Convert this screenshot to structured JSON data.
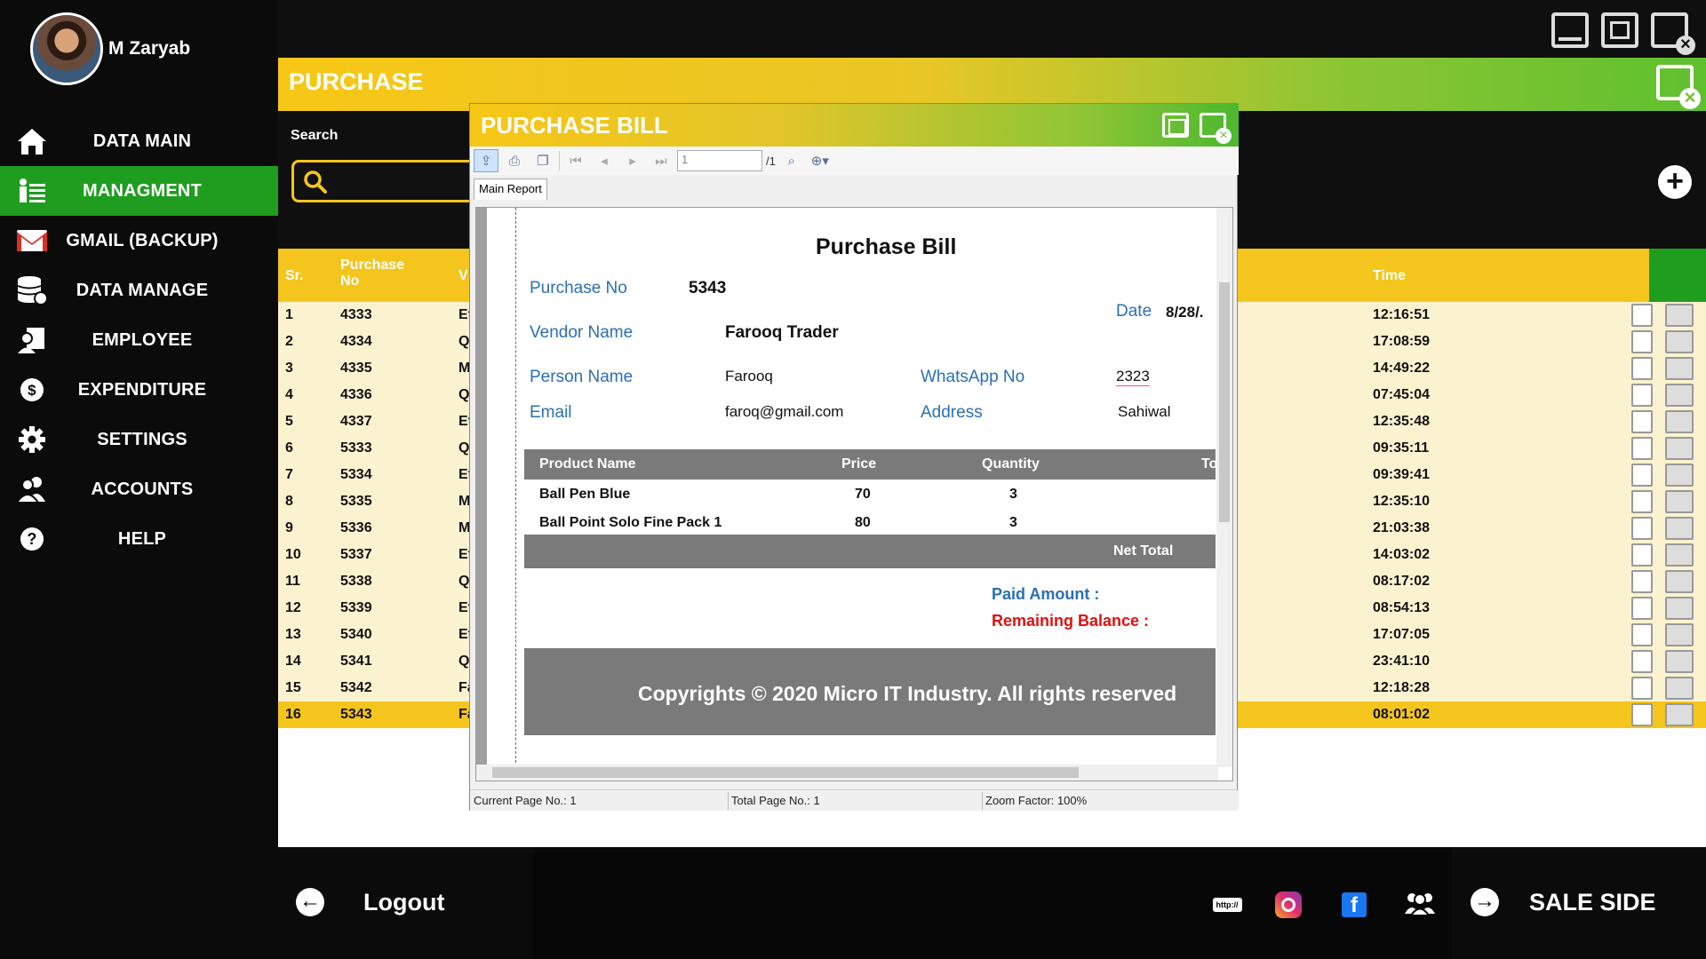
{
  "user": {
    "name": "M Zaryab"
  },
  "nav": [
    {
      "label": "DATA MAIN",
      "icon": "home-icon"
    },
    {
      "label": "MANAGMENT",
      "icon": "management-icon",
      "active": true
    },
    {
      "label": "GMAIL (BACKUP)",
      "icon": "gmail-icon"
    },
    {
      "label": "DATA MANAGE",
      "icon": "database-icon"
    },
    {
      "label": "EMPLOYEE",
      "icon": "employee-icon"
    },
    {
      "label": "EXPENDITURE",
      "icon": "dollar-icon"
    },
    {
      "label": "SETTINGS",
      "icon": "gear-icon"
    },
    {
      "label": "ACCOUNTS",
      "icon": "accounts-icon"
    },
    {
      "label": "HELP",
      "icon": "help-icon"
    }
  ],
  "page": {
    "title": "PURCHASE",
    "search_label": "Search"
  },
  "table": {
    "headers": {
      "sr": "Sr.",
      "purchase_no_1": "Purchase",
      "purchase_no_2": "No",
      "vendor": "V",
      "time": "Time"
    },
    "rows": [
      {
        "sr": "1",
        "no": "4333",
        "v": "Et",
        "time": "12:16:51"
      },
      {
        "sr": "2",
        "no": "4334",
        "v": "Q",
        "time": "17:08:59"
      },
      {
        "sr": "3",
        "no": "4335",
        "v": "M",
        "time": "14:49:22"
      },
      {
        "sr": "4",
        "no": "4336",
        "v": "Q",
        "time": "07:45:04"
      },
      {
        "sr": "5",
        "no": "4337",
        "v": "Et",
        "time": "12:35:48"
      },
      {
        "sr": "6",
        "no": "5333",
        "v": "Q",
        "time": "09:35:11"
      },
      {
        "sr": "7",
        "no": "5334",
        "v": "Et",
        "time": "09:39:41"
      },
      {
        "sr": "8",
        "no": "5335",
        "v": "M",
        "time": "12:35:10"
      },
      {
        "sr": "9",
        "no": "5336",
        "v": "M",
        "time": "21:03:38"
      },
      {
        "sr": "10",
        "no": "5337",
        "v": "Et",
        "time": "14:03:02"
      },
      {
        "sr": "11",
        "no": "5338",
        "v": "Q",
        "time": "08:17:02"
      },
      {
        "sr": "12",
        "no": "5339",
        "v": "Et",
        "time": "08:54:13"
      },
      {
        "sr": "13",
        "no": "5340",
        "v": "Et",
        "time": "17:07:05"
      },
      {
        "sr": "14",
        "no": "5341",
        "v": "Q",
        "time": "23:41:10"
      },
      {
        "sr": "15",
        "no": "5342",
        "v": "Fa",
        "time": "12:18:28"
      },
      {
        "sr": "16",
        "no": "5343",
        "v": "Fa",
        "time": "08:01:02",
        "selected": true
      }
    ]
  },
  "footer": {
    "logout": "Logout",
    "sale_side": "SALE SIDE",
    "http_text": "http://"
  },
  "dialog": {
    "title": "PURCHASE BILL",
    "page_input": "1",
    "page_total": "/1",
    "tab": "Main Report",
    "report": {
      "title": "Purchase Bill",
      "purchase_no_label": "Purchase No",
      "purchase_no": "5343",
      "date_label": "Date",
      "date": "8/28/.",
      "vendor_label": "Vendor Name",
      "vendor": "Farooq Trader",
      "person_label": "Person Name",
      "person": "Farooq",
      "whatsapp_label": "WhatsApp No",
      "whatsapp": "2323",
      "email_label": "Email",
      "email": "faroq@gmail.com",
      "address_label": "Address",
      "address": "Sahiwal",
      "col_product": "Product Name",
      "col_price": "Price",
      "col_qty": "Quantity",
      "col_total": "To",
      "items": [
        {
          "name": "Ball Pen Blue",
          "price": "70",
          "qty": "3"
        },
        {
          "name": "Ball Point Solo Fine Pack 1",
          "price": "80",
          "qty": "3"
        }
      ],
      "net_total": "Net Total",
      "paid": "Paid Amount :",
      "remaining": "Remaining Balance :",
      "copyright": "Copyrights © 2020 Micro IT Industry. All rights reserved"
    },
    "status": {
      "current": "Current Page No.: 1",
      "total": "Total Page No.: 1",
      "zoom": "Zoom Factor: 100%"
    }
  }
}
